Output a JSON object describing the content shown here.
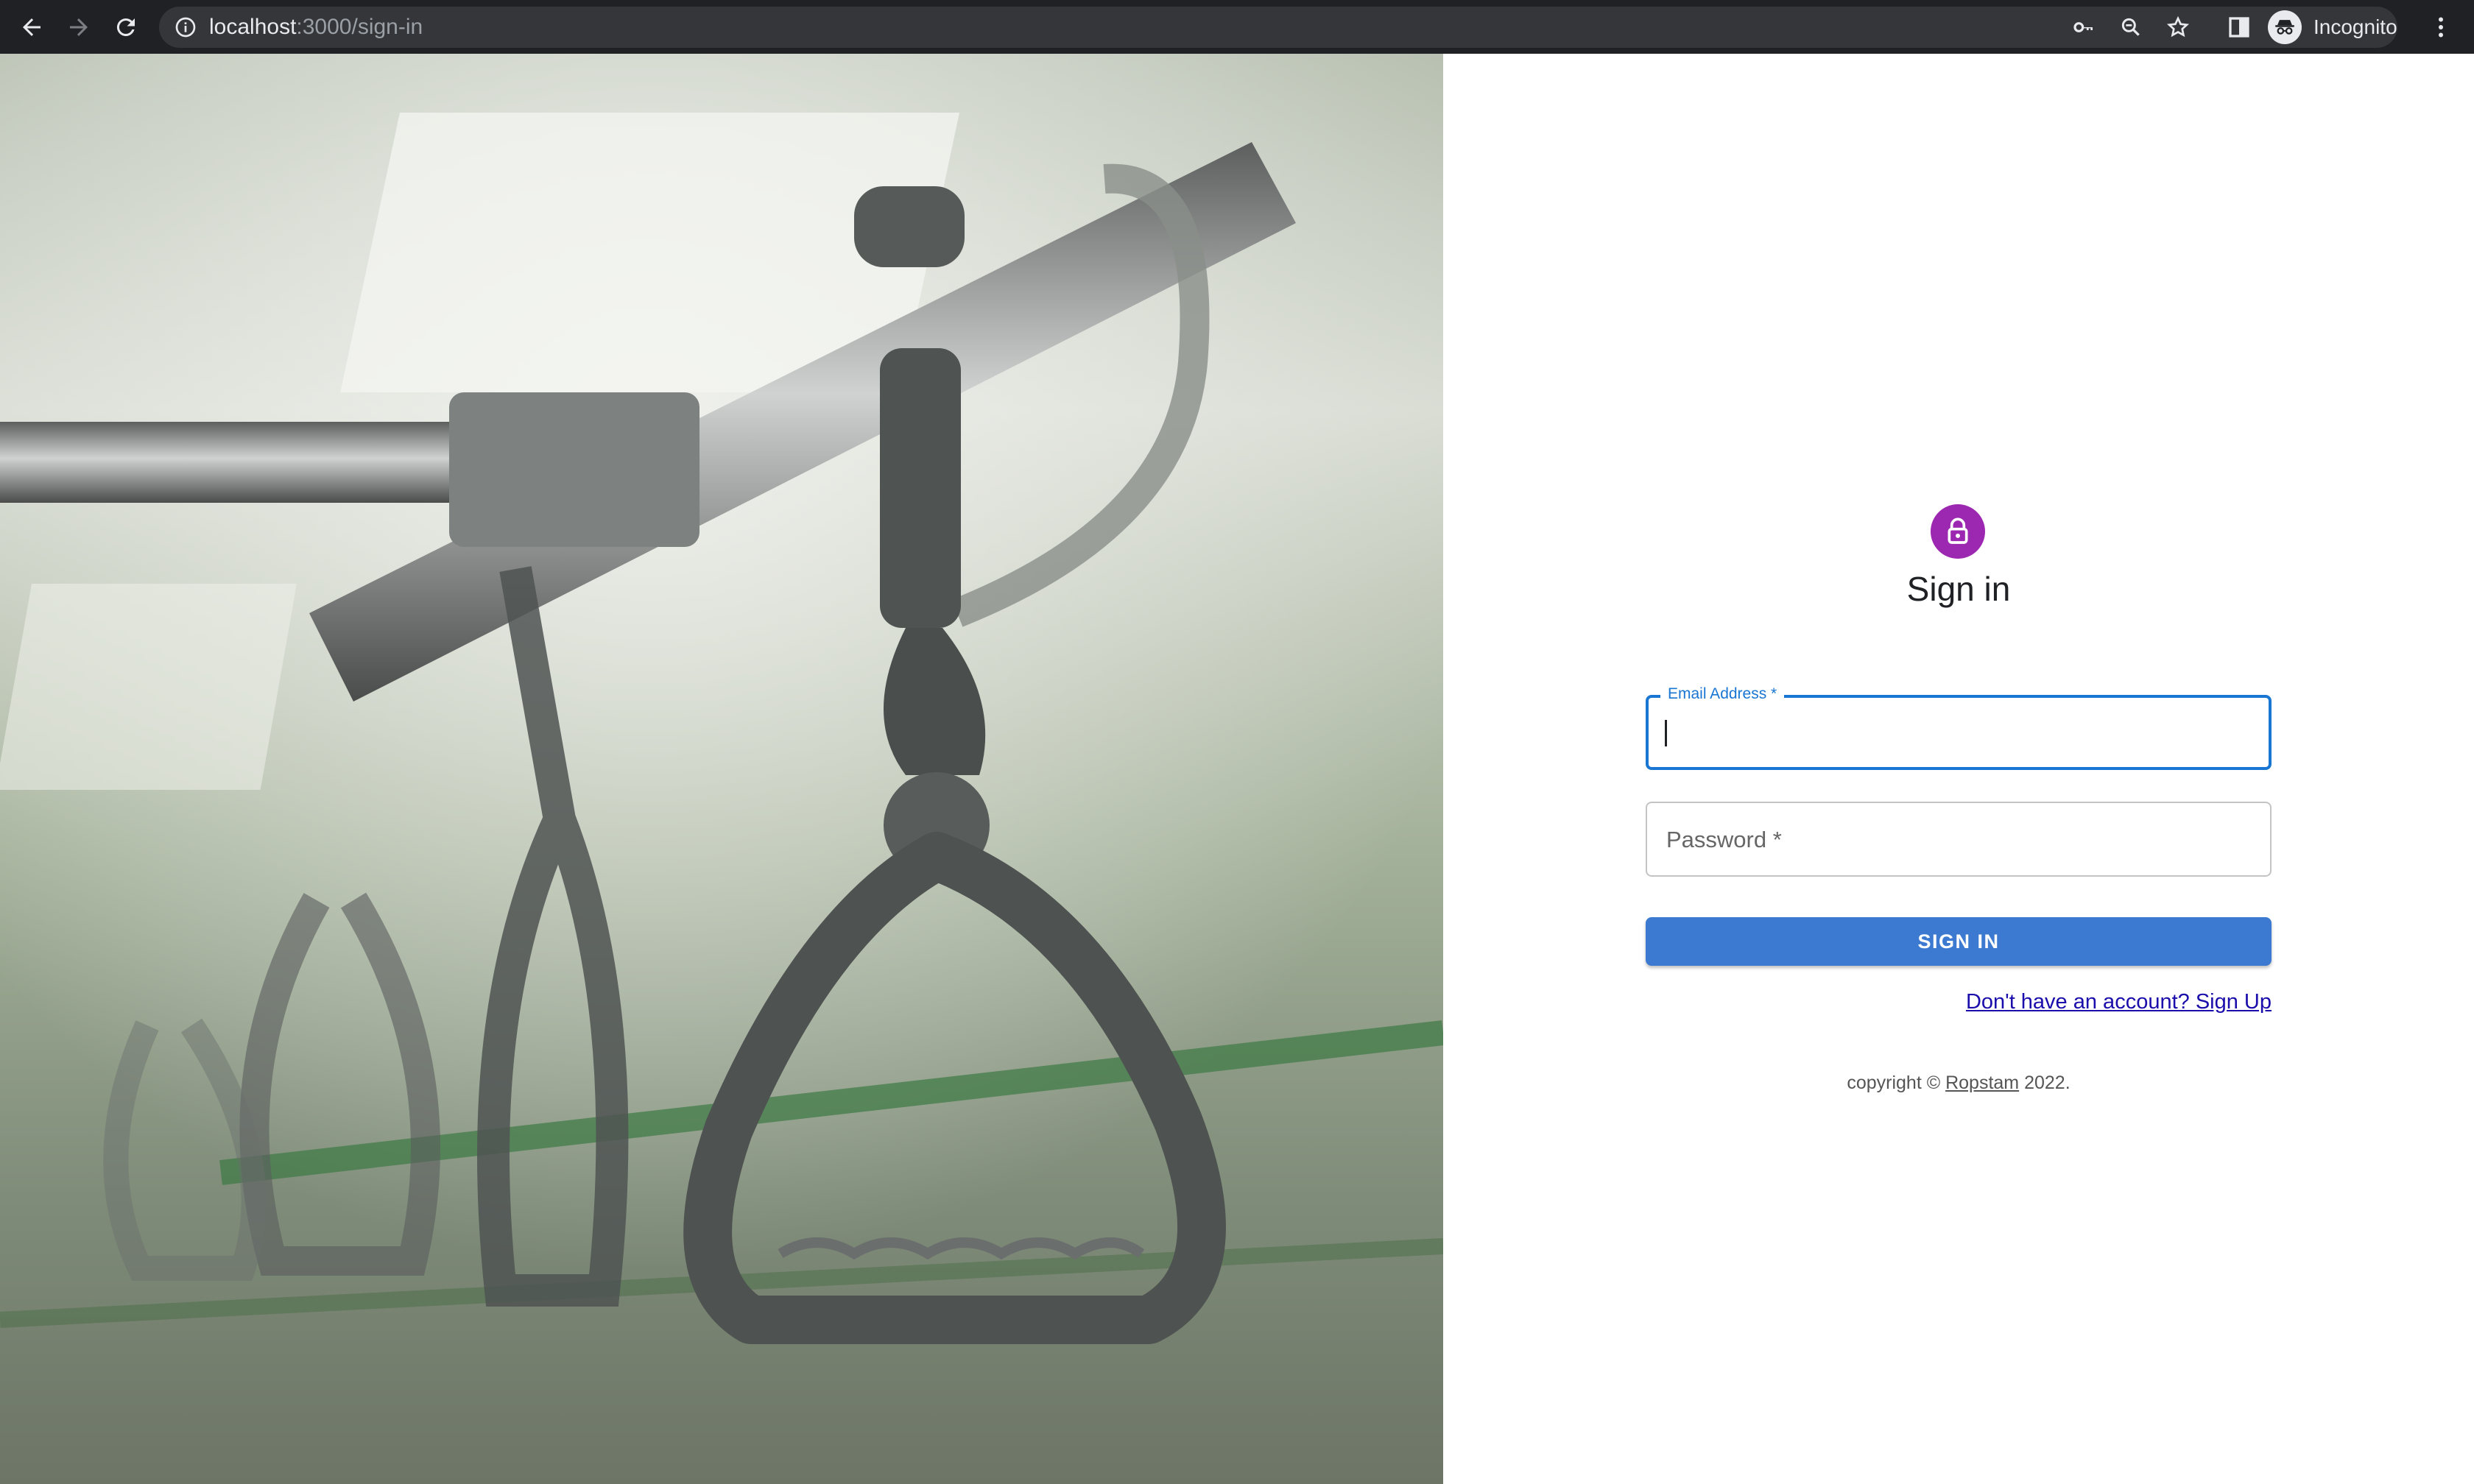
{
  "browser": {
    "url_host": "localhost",
    "url_path": ":3000/sign-in",
    "profile_label": "Incognito",
    "icons": [
      "back-arrow-icon",
      "forward-arrow-icon",
      "reload-icon",
      "info-icon",
      "key-icon",
      "zoom-icon",
      "star-icon",
      "side-panel-icon",
      "incognito-icon",
      "kebab-menu-icon"
    ]
  },
  "signin": {
    "icon": "lock-icon",
    "title": "Sign in",
    "email_label": "Email Address *",
    "password_label": "Password *",
    "submit_label": "SIGN IN",
    "signup_link": "Don't have an account? Sign Up",
    "copyright_prefix": "copyright ©",
    "copyright_brand": "Ropstam",
    "copyright_suffix": "2022.",
    "accent_color": "#9c27b0",
    "focus_color": "#1976d2",
    "button_color": "#3b7ad0"
  }
}
